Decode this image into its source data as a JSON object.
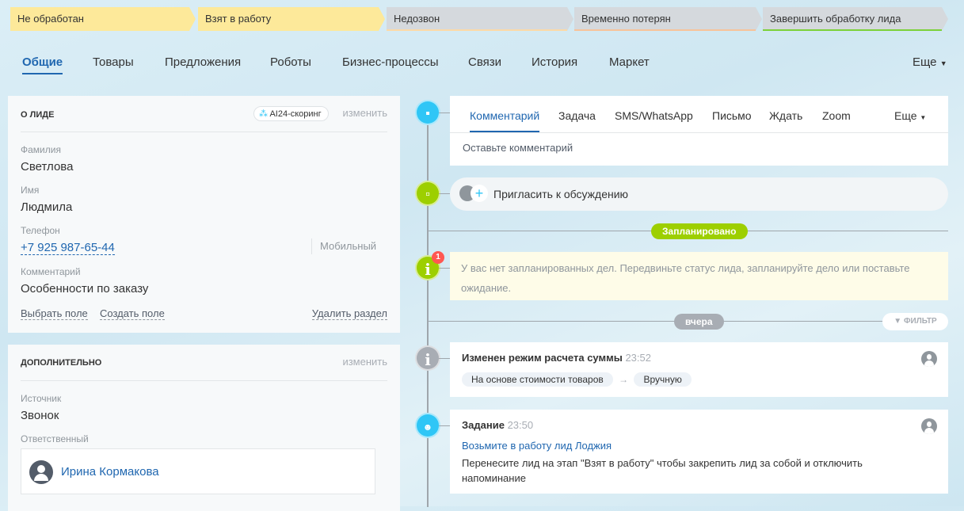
{
  "stages": [
    {
      "label": "Не обработан",
      "state": "done",
      "color": "#fde99a"
    },
    {
      "label": "Взят в работу",
      "state": "done",
      "color": "#fde99a"
    },
    {
      "label": "Недозвон",
      "state": "pending",
      "bar": "#fcd9a7"
    },
    {
      "label": "Временно потерян",
      "state": "pending",
      "bar": "#f7c39a"
    },
    {
      "label": "Завершить обработку лида",
      "state": "pending",
      "bar": "#7bd13a"
    }
  ],
  "tabs": [
    "Общие",
    "Товары",
    "Предложения",
    "Роботы",
    "Бизнес-процессы",
    "Связи",
    "История",
    "Маркет"
  ],
  "tabs_more": "Еще",
  "about": {
    "title": "О лиде",
    "scoring": "AI24-скоринг",
    "edit": "изменить",
    "fields": [
      {
        "label": "Фамилия",
        "value": "Светлова"
      },
      {
        "label": "Имя",
        "value": "Людмила"
      },
      {
        "label": "Телефон",
        "value": "+7 925 987-65-44",
        "type": "Мобильный"
      },
      {
        "label": "Комментарий",
        "value": "Особенности по заказу"
      }
    ],
    "select_field": "Выбрать поле",
    "create_field": "Создать поле",
    "delete_section": "Удалить раздел"
  },
  "additional": {
    "title": "Дополнительно",
    "edit": "изменить",
    "source_label": "Источник",
    "source_value": "Звонок",
    "responsible_label": "Ответственный",
    "responsible_name": "Ирина Кормакова"
  },
  "editor": {
    "tabs": [
      "Комментарий",
      "Задача",
      "SMS/WhatsApp",
      "Письмо",
      "Ждать",
      "Zoom"
    ],
    "more": "Еще",
    "placeholder": "Оставьте комментарий"
  },
  "invite": "Пригласить к обсуждению",
  "planned": {
    "label": "Запланировано",
    "badge": "1",
    "text": "У вас нет запланированных дел. Передвиньте статус лида, запланируйте дело или поставьте ожидание."
  },
  "yesterday": "вчера",
  "filter": "Фильтр",
  "events": [
    {
      "title": "Изменен режим расчета суммы",
      "time": "23:52",
      "from": "На основе стоимости товаров",
      "to": "Вручную"
    },
    {
      "title": "Задание",
      "time": "23:50",
      "link": "Возьмите в работу лид Лоджия",
      "text": "Перенесите лид на этап \"Взят в работу\" чтобы закрепить лид за собой и отключить напоминание"
    }
  ],
  "colors": {
    "accent": "#2067b0",
    "green": "#9dcf00",
    "blue": "#2fc6f6",
    "gray": "#a8adb4"
  }
}
